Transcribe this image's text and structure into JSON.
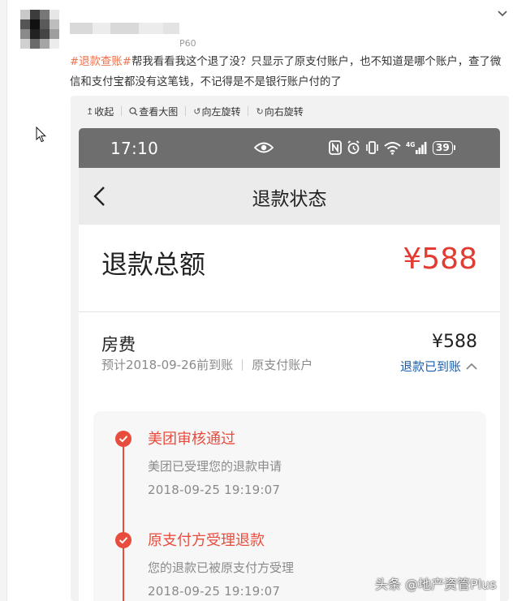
{
  "post": {
    "device_suffix": "P60",
    "topic_tag": "#退款查账#",
    "body": "帮我看看我这个退了没？只显示了原支付账户，也不知道是哪个账户，查了微信和支付宝都没有这笔钱，不记得是不是银行账户付的了"
  },
  "image_toolbar": {
    "collapse": "收起",
    "view_large": "查看大图",
    "rotate_left": "向左旋转",
    "rotate_right": "向右旋转"
  },
  "phone": {
    "status_bar": {
      "time": "17:10",
      "battery": "39"
    },
    "nav": {
      "title": "退款状态"
    },
    "total": {
      "label": "退款总额",
      "value": "¥588"
    },
    "item": {
      "name": "房费",
      "expected": "预计2018-09-26前到账",
      "account": "原支付账户",
      "amount": "¥588",
      "status": "退款已到账"
    },
    "timeline": [
      {
        "title": "美团审核通过",
        "desc": "美团已受理您的退款申请",
        "time": "2018-09-25 19:19:07"
      },
      {
        "title": "原支付方受理退款",
        "desc": "您的退款已被原支付方受理",
        "time": "2018-09-25 19:19:07"
      }
    ]
  },
  "watermark": "头条 @地产资管Plus",
  "colors": {
    "topic": "#eb7350",
    "refund_red": "#e23b31",
    "status_blue": "#1b5dab",
    "timeline_red": "#e84c3d"
  }
}
